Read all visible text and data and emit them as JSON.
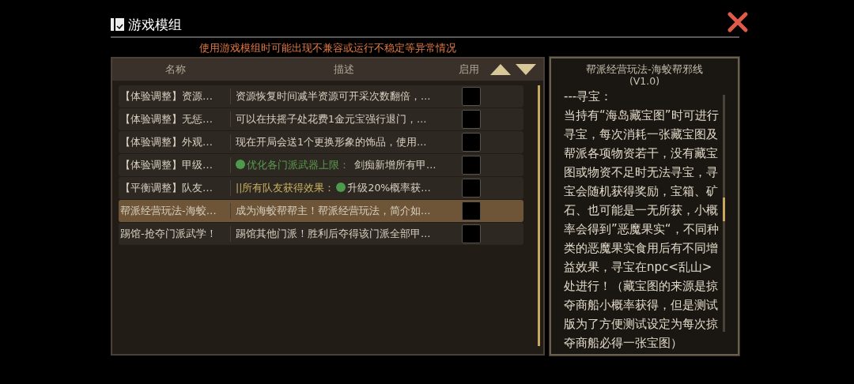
{
  "window": {
    "title": "游戏模组"
  },
  "warning": "使用游戏模组时可能出现不兼容或运行不稳定等异常情况",
  "table": {
    "columns": [
      "名称",
      "描述",
      "启用"
    ],
    "rows": [
      {
        "name": "【体验调整】资源…",
        "description": [
          {
            "kind": "plain",
            "text": "资源恢复时间减半资源可开采次数翻倍，…"
          }
        ],
        "enabled": false,
        "selected": false
      },
      {
        "name": "【体验调整】无惩…",
        "description": [
          {
            "kind": "plain",
            "text": "可以在扶摇子处花费1金元宝强行退门，…"
          }
        ],
        "enabled": false,
        "selected": false
      },
      {
        "name": "【体验调整】外观…",
        "description": [
          {
            "kind": "plain",
            "text": "现在开局会送1个更换形象的饰品，使用…"
          }
        ],
        "enabled": false,
        "selected": false
      },
      {
        "name": "【体验调整】甲级…",
        "description": [
          {
            "kind": "dot"
          },
          {
            "kind": "green",
            "text": "优化各门派武器上限："
          },
          {
            "kind": "plain",
            "text": "剑痴新增所有甲…"
          }
        ],
        "enabled": false,
        "selected": false
      },
      {
        "name": "【平衡调整】队友…",
        "description": [
          {
            "kind": "gold",
            "text": "||所有队友获得效果："
          },
          {
            "kind": "dot"
          },
          {
            "kind": "plain",
            "text": "升级20%概率获…"
          }
        ],
        "enabled": false,
        "selected": false
      },
      {
        "name": "帮派经营玩法-海蛟…",
        "description": [
          {
            "kind": "plain",
            "text": "成为海蛟帮帮主！帮派经营玩法，简介如…"
          }
        ],
        "enabled": false,
        "selected": true
      },
      {
        "name": "踢馆-抢夺门派武学！",
        "description": [
          {
            "kind": "plain",
            "text": "踢馆其他门派！胜利后夺得该门派全部甲…"
          }
        ],
        "enabled": false,
        "selected": false
      }
    ]
  },
  "detail": {
    "title": "帮派经营玩法-海蛟帮邪线",
    "version": "(V1.0)",
    "body": [
      "---寻宝：",
      "当持有“海岛藏宝图”时可进行寻宝，每次消耗一张藏宝图及帮派各项物资若干，没有藏宝图或物资不足时无法寻宝，寻宝会随机获得奖励，宝箱、矿石、也可能是一无所获，小概率会得到”恶魔果实“，不同种类的恶魔果实食用后有不同增益效果，寻宝在npc<乱山>处进行！（藏宝图的来源是掠夺商船小概率获得，但是测试版为了方便测试设定为每次掠夺商船必得一张宝图）"
    ]
  }
}
